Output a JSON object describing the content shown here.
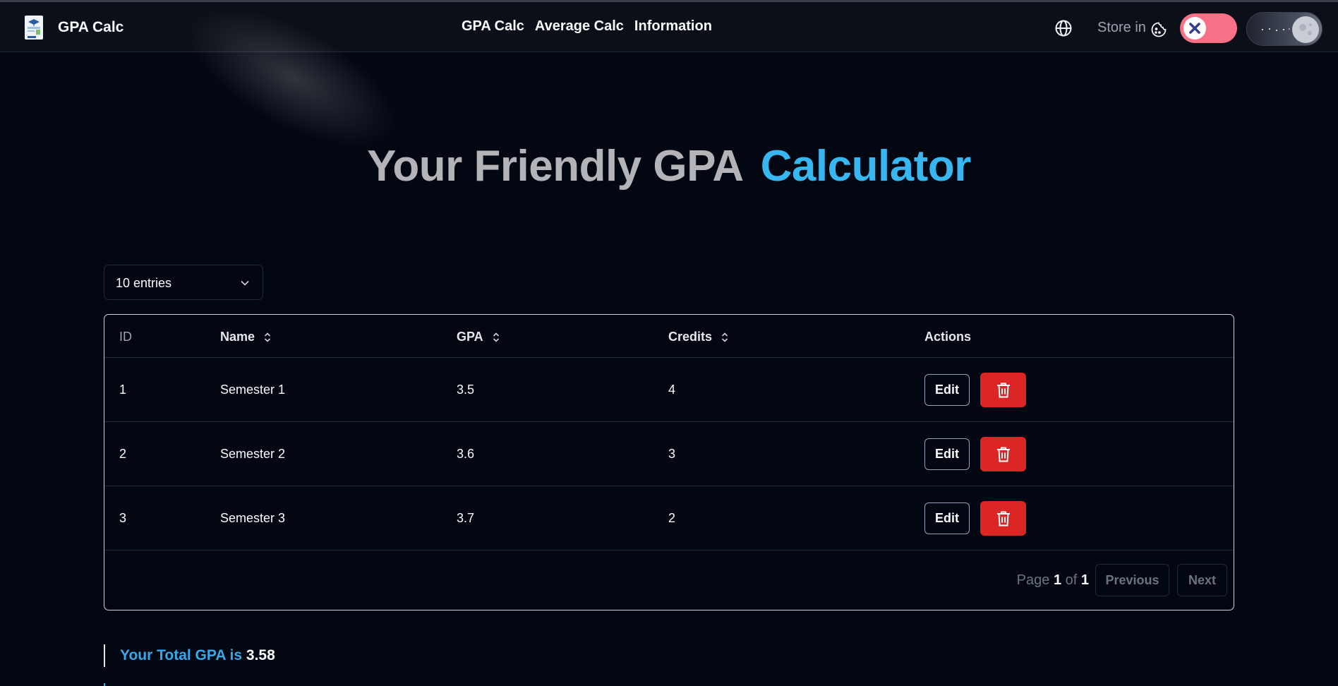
{
  "header": {
    "brand": "GPA Calc",
    "nav": [
      "GPA Calc",
      "Average Calc",
      "Information"
    ],
    "store_label": "Store in",
    "store_toggle": "off",
    "theme_toggle": "dark"
  },
  "hero": {
    "title_part1": "Your Friendly GPA",
    "title_part2": "Calculator"
  },
  "table_controls": {
    "entries_selected": "10 entries"
  },
  "table": {
    "columns": [
      "ID",
      "Name",
      "GPA",
      "Credits",
      "Actions"
    ],
    "rows": [
      {
        "id": "1",
        "name": "Semester 1",
        "gpa": "3.5",
        "credits": "4"
      },
      {
        "id": "2",
        "name": "Semester 2",
        "gpa": "3.6",
        "credits": "3"
      },
      {
        "id": "3",
        "name": "Semester 3",
        "gpa": "3.7",
        "credits": "2"
      }
    ],
    "edit_label": "Edit",
    "delete_icon": "trash-icon"
  },
  "pagination": {
    "page_word": "Page",
    "current": "1",
    "of_word": "of",
    "total": "1",
    "previous": "Previous",
    "next": "Next"
  },
  "summary": {
    "label": "Your Total GPA is",
    "value": "3.58"
  },
  "colors": {
    "background": "#030712",
    "accent": "#38b6f0",
    "danger": "#dc2626",
    "toggle_off": "#f87187"
  }
}
